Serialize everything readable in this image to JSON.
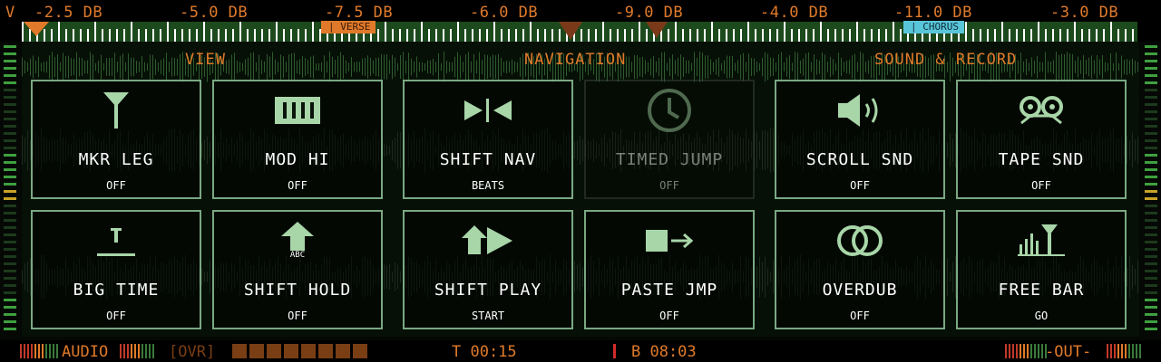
{
  "ruler": {
    "v_label": "V",
    "db_labels": [
      "-2.5 DB",
      "-5.0 DB",
      "-7.5 DB",
      "-6.0 DB",
      "-9.0 DB",
      "-4.0 DB",
      "-11.0 DB",
      "-3.0 DB"
    ],
    "markers": {
      "verse": "| VERSE",
      "chorus": "| CHORUS"
    }
  },
  "sections": {
    "view": "VIEW",
    "navigation": "NAVIGATION",
    "sound_record": "SOUND & RECORD"
  },
  "tiles": [
    {
      "name": "MKR LEG",
      "state": "OFF",
      "icon": "antenna-icon"
    },
    {
      "name": "MOD HI",
      "state": "OFF",
      "icon": "meter-bars-icon"
    },
    {
      "name": "SHIFT NAV",
      "state": "BEATS",
      "icon": "nav-arrows-icon"
    },
    {
      "name": "TIMED JUMP",
      "state": "OFF",
      "icon": "clock-icon"
    },
    {
      "name": "SCROLL SND",
      "state": "OFF",
      "icon": "speaker-icon"
    },
    {
      "name": "TAPE SND",
      "state": "OFF",
      "icon": "tape-icon"
    },
    {
      "name": "BIG TIME",
      "state": "OFF",
      "icon": "text-cursor-icon"
    },
    {
      "name": "SHIFT HOLD",
      "state": "OFF",
      "icon": "shift-arrow-icon",
      "sublabel": "ABC"
    },
    {
      "name": "SHIFT PLAY",
      "state": "START",
      "icon": "shift-play-icon"
    },
    {
      "name": "PASTE JMP",
      "state": "OFF",
      "icon": "paste-jump-icon"
    },
    {
      "name": "OVERDUB",
      "state": "OFF",
      "icon": "overdub-icon"
    },
    {
      "name": "FREE BAR",
      "state": "GO",
      "icon": "free-bar-icon"
    }
  ],
  "bottom": {
    "audio": "AUDIO",
    "ovr": "[OVR]",
    "time": "T 00:15",
    "bar": "B 08:03",
    "out": "-OUT-"
  },
  "colors": {
    "accent": "#e07a2a",
    "tile_border": "#7aa882",
    "icon": "#a8d6a8",
    "chorus": "#59c5d9"
  }
}
